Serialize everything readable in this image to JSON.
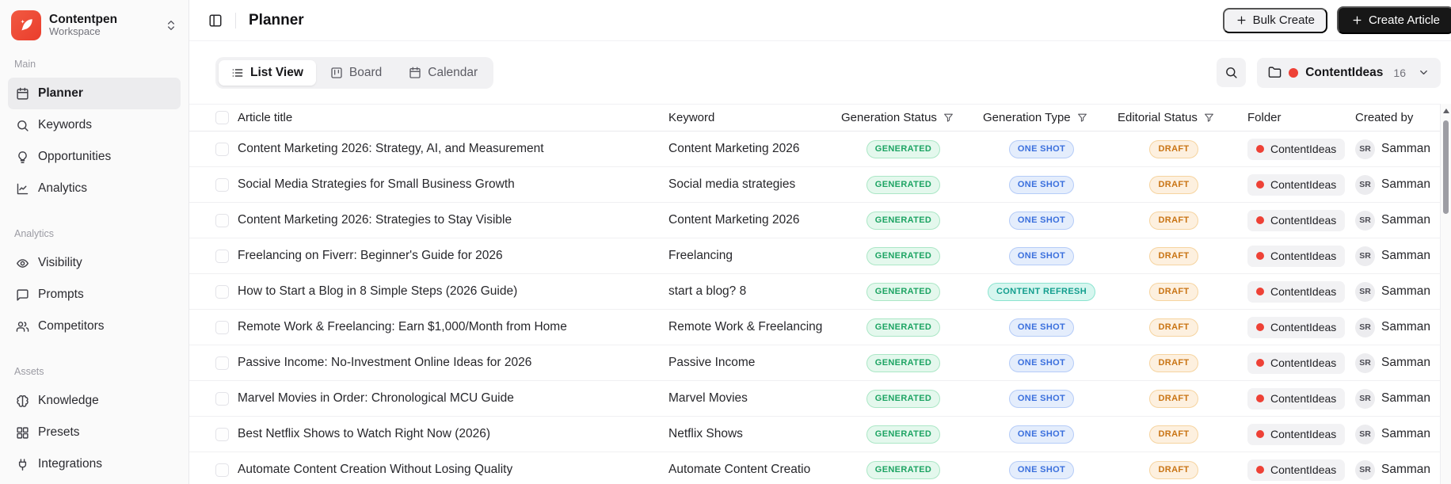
{
  "workspace": {
    "name": "Contentpen",
    "subtitle": "Workspace"
  },
  "sidebar": {
    "sections": [
      {
        "label": "Main",
        "items": [
          {
            "label": "Planner",
            "icon": "calendar",
            "active": true
          },
          {
            "label": "Keywords",
            "icon": "search",
            "active": false
          },
          {
            "label": "Opportunities",
            "icon": "lightbulb",
            "active": false
          },
          {
            "label": "Analytics",
            "icon": "chart",
            "active": false
          }
        ]
      },
      {
        "label": "Analytics",
        "items": [
          {
            "label": "Visibility",
            "icon": "eye",
            "active": false
          },
          {
            "label": "Prompts",
            "icon": "chat",
            "active": false
          },
          {
            "label": "Competitors",
            "icon": "users",
            "active": false
          }
        ]
      },
      {
        "label": "Assets",
        "items": [
          {
            "label": "Knowledge",
            "icon": "brain",
            "active": false
          },
          {
            "label": "Presets",
            "icon": "grid",
            "active": false
          },
          {
            "label": "Integrations",
            "icon": "plug",
            "active": false
          }
        ]
      }
    ]
  },
  "header": {
    "title": "Planner",
    "bulk_create_label": "Bulk Create",
    "create_article_label": "Create Article"
  },
  "toolbar": {
    "tabs": [
      {
        "label": "List View",
        "icon": "list",
        "active": true
      },
      {
        "label": "Board",
        "icon": "board",
        "active": false
      },
      {
        "label": "Calendar",
        "icon": "calendar",
        "active": false
      }
    ],
    "folder_selector": {
      "name": "ContentIdeas",
      "count": "16"
    }
  },
  "table": {
    "columns": [
      "Article title",
      "Keyword",
      "Generation Status",
      "Generation Type",
      "Editorial Status",
      "Folder",
      "Created by"
    ],
    "rows": [
      {
        "title": "Content Marketing 2026: Strategy, AI, and Measurement",
        "keyword": "Content Marketing 2026",
        "generation_status": "GENERATED",
        "generation_type": "ONE SHOT",
        "editorial_status": "DRAFT",
        "folder": "ContentIdeas",
        "creator_initials": "SR",
        "creator_name": "Samman"
      },
      {
        "title": "Social Media Strategies for Small Business Growth",
        "keyword": "Social media strategies",
        "generation_status": "GENERATED",
        "generation_type": "ONE SHOT",
        "editorial_status": "DRAFT",
        "folder": "ContentIdeas",
        "creator_initials": "SR",
        "creator_name": "Samman"
      },
      {
        "title": "Content Marketing 2026: Strategies to Stay Visible",
        "keyword": "Content Marketing 2026",
        "generation_status": "GENERATED",
        "generation_type": "ONE SHOT",
        "editorial_status": "DRAFT",
        "folder": "ContentIdeas",
        "creator_initials": "SR",
        "creator_name": "Samman"
      },
      {
        "title": "Freelancing on Fiverr: Beginner's Guide for 2026",
        "keyword": "Freelancing",
        "generation_status": "GENERATED",
        "generation_type": "ONE SHOT",
        "editorial_status": "DRAFT",
        "folder": "ContentIdeas",
        "creator_initials": "SR",
        "creator_name": "Samman"
      },
      {
        "title": "How to Start a Blog in 8 Simple Steps (2026 Guide)",
        "keyword": "start a blog? 8",
        "generation_status": "GENERATED",
        "generation_type": "CONTENT REFRESH",
        "editorial_status": "DRAFT",
        "folder": "ContentIdeas",
        "creator_initials": "SR",
        "creator_name": "Samman"
      },
      {
        "title": "Remote Work & Freelancing: Earn $1,000/Month from Home",
        "keyword": "Remote Work & Freelancing",
        "generation_status": "GENERATED",
        "generation_type": "ONE SHOT",
        "editorial_status": "DRAFT",
        "folder": "ContentIdeas",
        "creator_initials": "SR",
        "creator_name": "Samman"
      },
      {
        "title": "Passive Income: No-Investment Online Ideas for 2026",
        "keyword": "Passive Income",
        "generation_status": "GENERATED",
        "generation_type": "ONE SHOT",
        "editorial_status": "DRAFT",
        "folder": "ContentIdeas",
        "creator_initials": "SR",
        "creator_name": "Samman"
      },
      {
        "title": "Marvel Movies in Order: Chronological MCU Guide",
        "keyword": "Marvel Movies",
        "generation_status": "GENERATED",
        "generation_type": "ONE SHOT",
        "editorial_status": "DRAFT",
        "folder": "ContentIdeas",
        "creator_initials": "SR",
        "creator_name": "Samman"
      },
      {
        "title": "Best Netflix Shows to Watch Right Now (2026)",
        "keyword": "Netflix Shows",
        "generation_status": "GENERATED",
        "generation_type": "ONE SHOT",
        "editorial_status": "DRAFT",
        "folder": "ContentIdeas",
        "creator_initials": "SR",
        "creator_name": "Samman"
      },
      {
        "title": "Automate Content Creation Without Losing Quality",
        "keyword": "Automate Content Creatio",
        "generation_status": "GENERATED",
        "generation_type": "ONE SHOT",
        "editorial_status": "DRAFT",
        "folder": "ContentIdeas",
        "creator_initials": "SR",
        "creator_name": "Samman"
      }
    ]
  },
  "colors": {
    "brand": "#ee4c38",
    "folder_dot": "#ee4136",
    "status_generated": "#1da463",
    "type_one_shot": "#3a6fdd",
    "type_content_refresh": "#139e8e",
    "editorial_draft": "#c97414",
    "primary_button": "#171717"
  }
}
